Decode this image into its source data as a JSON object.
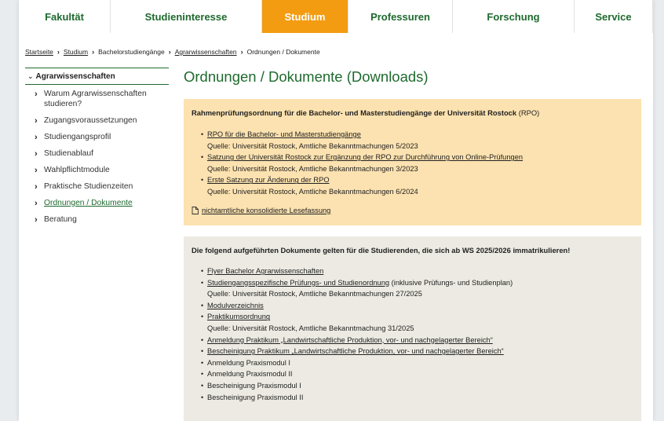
{
  "nav": {
    "items": [
      {
        "label": "Fakultät"
      },
      {
        "label": "Studieninteresse"
      },
      {
        "label": "Studium"
      },
      {
        "label": "Professuren"
      },
      {
        "label": "Forschung"
      },
      {
        "label": "Service"
      }
    ],
    "active_index": 2
  },
  "breadcrumb": {
    "items": [
      "Startseite",
      "Studium",
      "Bachelorstudiengänge",
      "Agrarwissenschaften",
      "Ordnungen / Dokumente"
    ],
    "separator": "›"
  },
  "sidebar": {
    "heading": "Agrarwissenschaften",
    "items": [
      {
        "label": "Warum Agrarwissenschaften studieren?"
      },
      {
        "label": "Zugangsvoraussetzungen"
      },
      {
        "label": "Studiengangsprofil"
      },
      {
        "label": "Studienablauf"
      },
      {
        "label": "Wahlpflichtmodule"
      },
      {
        "label": "Praktische Studienzeiten"
      },
      {
        "label": "Ordnungen / Dokumente"
      },
      {
        "label": "Beratung"
      }
    ],
    "active_index": 6
  },
  "main": {
    "title": "Ordnungen / Dokumente (Downloads)",
    "box1": {
      "heading_bold": "Rahmenprüfungsordnung für die Bachelor- und Masterstudiengänge der Universität Rostock",
      "heading_suffix": "(RPO)",
      "items": [
        {
          "link": "RPO für die Bachelor- und Masterstudiengänge",
          "source": "Quelle: Universität Rostock, Amtliche Bekanntmachungen 5/2023"
        },
        {
          "link": "Satzung der Universität Rostock zur Ergänzung der RPO zur Durchführung von Online-Prüfungen",
          "source": "Quelle: Universität Rostock, Amtliche Bekanntmachungen 3/2023"
        },
        {
          "link": "Erste Satzung zur Änderung der RPO",
          "source": "Quelle: Universität Rostock, Amtliche Bekanntmachungen 6/2024"
        }
      ],
      "lesefassung": "nichtamtliche konsolidierte Lesefassung"
    },
    "box2": {
      "heading": "Die folgend aufgeführten Dokumente gelten für die Studierenden, die sich ab WS 2025/2026 immatrikulieren!",
      "items": [
        {
          "link": "Flyer Bachelor Agrarwissenschaften"
        },
        {
          "link": "Studiengangsspezifische Prüfungs- und Studienordnung",
          "suffix": "(inklusive Prüfungs- und Studienplan)",
          "source": "Quelle: Universität Rostock, Amtliche Bekanntmachungen 27/2025"
        },
        {
          "link": "Modulverzeichnis"
        },
        {
          "link": "Praktikumsordnung",
          "source": "Quelle: Universität Rostock, Amtliche Bekanntmachung 31/2025"
        },
        {
          "link": "Anmeldung Praktikum „Landwirtschaftliche Produktion, vor- und nachgelagerter Bereich“"
        },
        {
          "link": "Bescheinigung Praktikum „Landwirtschaftliche Produktion, vor- und nachgelagerter Bereich“"
        },
        {
          "text": "Anmeldung Praxismodul I"
        },
        {
          "text": "Anmeldung Praxismodul II"
        },
        {
          "text": "Bescheinigung Praxismodul I"
        },
        {
          "text": "Bescheinigung Praxismodul II"
        }
      ]
    }
  },
  "colors": {
    "brand_green": "#1e6a2e",
    "accent_orange": "#f39c12",
    "box1_bg": "#fce2b0",
    "box2_bg": "#eceae2"
  },
  "icons": {
    "sidebar_heading": "chevron-down-icon",
    "sidebar_item": "chevron-right-icon",
    "lesefassung": "document-icon"
  }
}
